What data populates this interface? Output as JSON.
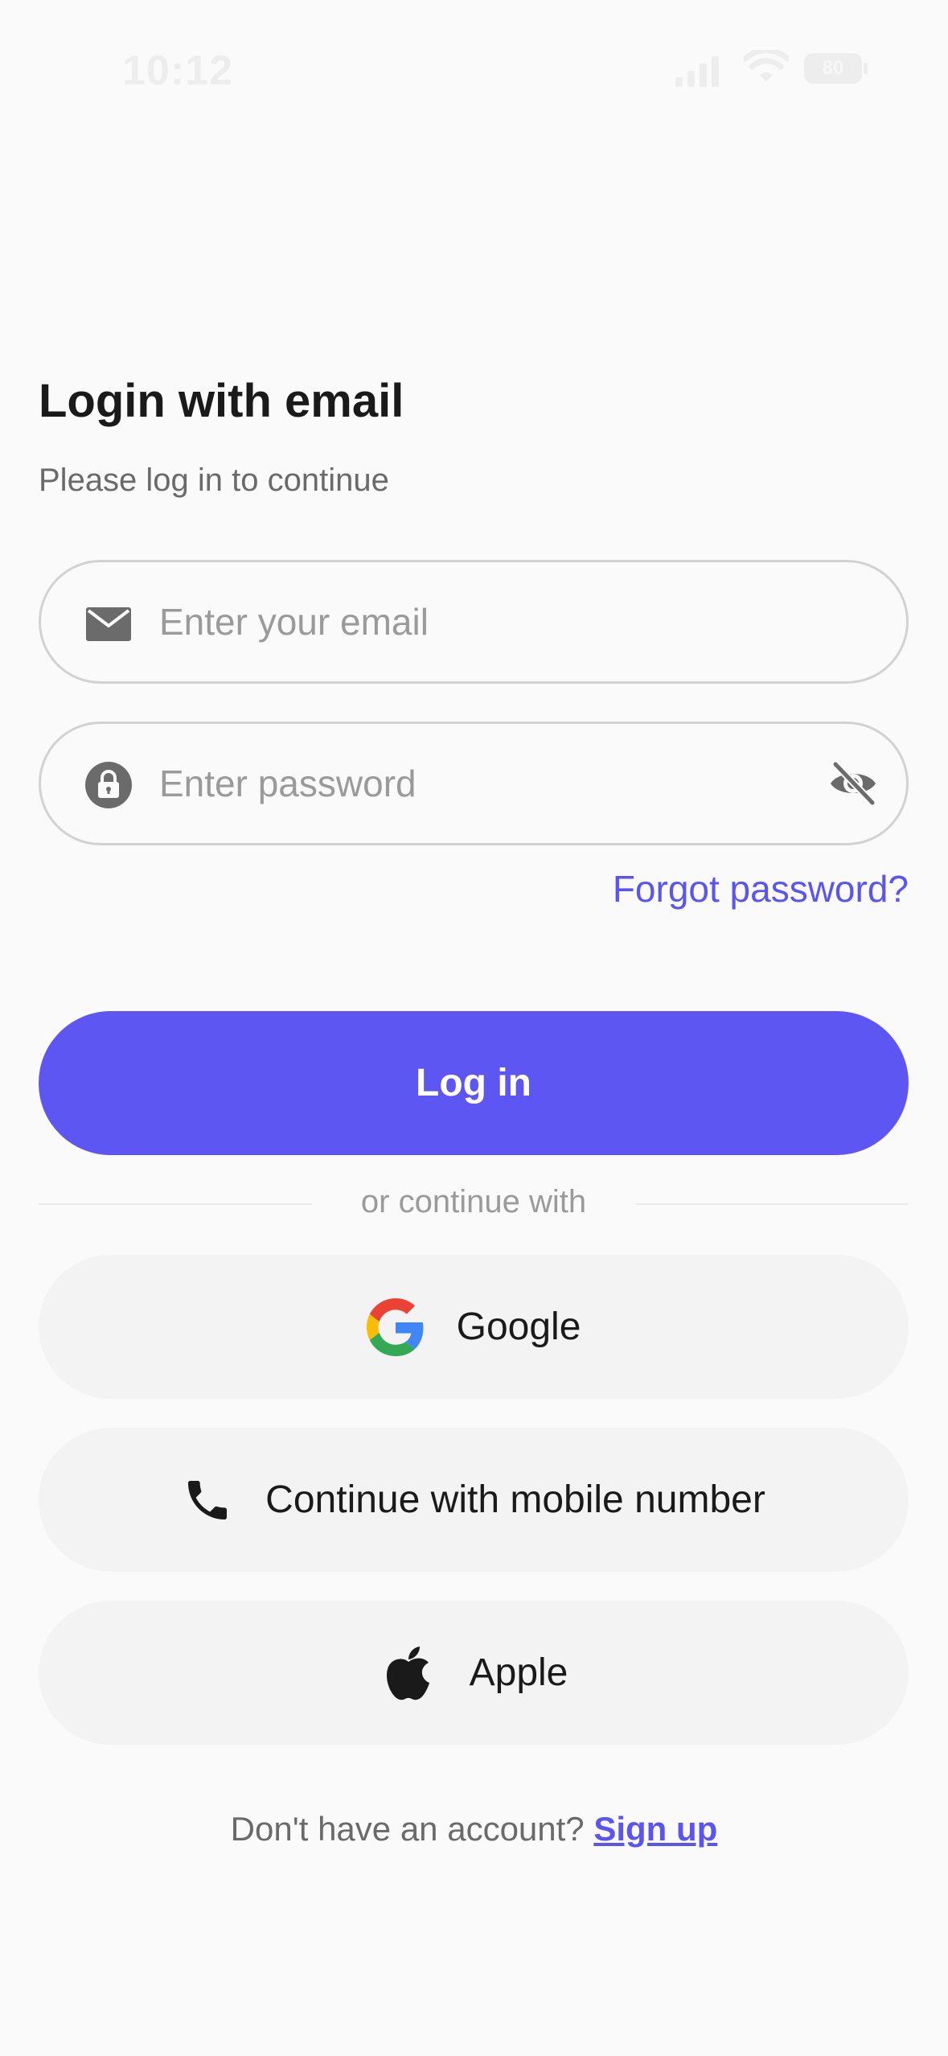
{
  "status_bar": {
    "time": "10:12",
    "battery": "80"
  },
  "header": {
    "title": "Login with email",
    "subtitle": "Please log in to continue"
  },
  "form": {
    "email": {
      "placeholder": "Enter your email",
      "value": "",
      "icon": "envelope-icon"
    },
    "password": {
      "placeholder": "Enter password",
      "value": "",
      "icon": "lock-icon",
      "toggle_icon": "eye-off-icon"
    },
    "forgot_password": "Forgot password?",
    "login_label": "Log in"
  },
  "divider": {
    "text": "or continue with"
  },
  "social": [
    {
      "label": "Google",
      "icon": "google-icon"
    },
    {
      "label": "Continue with mobile number",
      "icon": "phone-icon"
    },
    {
      "label": "Apple",
      "icon": "apple-icon"
    }
  ],
  "footer": {
    "prompt": "Don't have an account?",
    "signup_label": "Sign up"
  },
  "colors": {
    "accent": "#5E56F2",
    "link": "#5B54F0",
    "background": "#FAFAFA",
    "social_button_bg": "#F3F3F3",
    "input_border": "#D2D2D2"
  }
}
